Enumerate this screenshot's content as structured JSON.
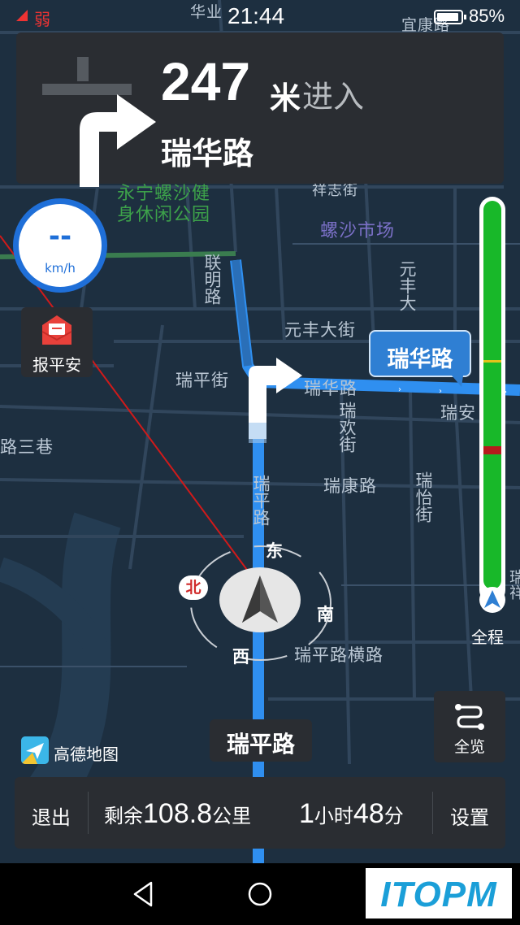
{
  "status_bar": {
    "signal": "弱",
    "time": "21:44",
    "battery": "85%"
  },
  "guidance": {
    "distance": "247",
    "unit": "米",
    "action": "进入",
    "road": "瑞华路"
  },
  "speed": {
    "value": "--",
    "unit": "km/h"
  },
  "safety": {
    "label": "报平安"
  },
  "route_callout": "瑞华路",
  "map_labels": {
    "park": "永宁螺沙健身休闲公园",
    "market": "螺沙市场",
    "lianming": "联明路",
    "yuanfeng_st": "元丰大街",
    "yuanfeng_v": "元丰大",
    "ruiping_st": "瑞平街",
    "ruihua_road": "瑞华路",
    "ruian": "瑞安",
    "ruihuan": "瑞欢街",
    "lane3": "路三巷",
    "ruikang": "瑞康路",
    "ruiyi": "瑞怡街",
    "ruiping_road": "瑞平路",
    "ruiping_heng": "瑞平路横路",
    "top_huaye": "华业",
    "top_yikang": "宜康路",
    "xiangzhi": "祥志街",
    "ruixiang": "瑞祥"
  },
  "compass": {
    "north": "北",
    "east": "东",
    "south": "南",
    "west": "西"
  },
  "progress": {
    "label": "全程",
    "traffic_colors": {
      "clear": "#18b829",
      "slow": "#e4c21b",
      "jam": "#b51c1c"
    }
  },
  "current_road": "瑞平路",
  "overview_button": "全览",
  "logo": "高德地图",
  "bottom_bar": {
    "exit": "退出",
    "remaining_label": "剩余",
    "remaining_value": "108.8",
    "remaining_unit": "公里",
    "eta_hours": "1",
    "eta_hour_unit": "小时",
    "eta_minutes": "48",
    "eta_minute_unit": "分",
    "settings": "设置"
  },
  "watermark": "ITOPM",
  "icons": {
    "turn": "turn-right-icon",
    "safety": "envelope-icon",
    "car": "navigation-arrow-icon",
    "overview": "route-overview-icon",
    "back": "back-icon",
    "home": "home-icon"
  }
}
